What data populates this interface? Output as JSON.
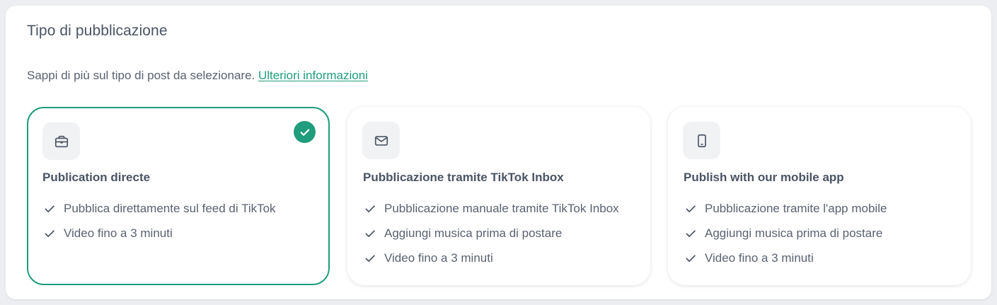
{
  "section": {
    "title": "Tipo di pubblicazione",
    "subtitle": "Sappi di più sul tipo di post da selezionare.",
    "link_label": "Ulteriori informazioni"
  },
  "cards": [
    {
      "title": "Publication directe",
      "icon": "briefcase-icon",
      "selected": true,
      "features": [
        "Pubblica direttamente sul feed di TikTok",
        "Video fino a 3 minuti"
      ]
    },
    {
      "title": "Pubblicazione tramite TikTok Inbox",
      "icon": "mail-icon",
      "selected": false,
      "features": [
        "Pubblicazione manuale tramite TikTok Inbox",
        "Aggiungi musica prima di postare",
        "Video fino a 3 minuti"
      ]
    },
    {
      "title": "Publish with our mobile app",
      "icon": "smartphone-icon",
      "selected": false,
      "features": [
        "Pubblicazione tramite l'app mobile",
        "Aggiungi musica prima di postare",
        "Video fino a 3 minuti"
      ]
    }
  ],
  "colors": {
    "accent": "#1f9d7c",
    "text": "#4a5463",
    "muted": "#5a6270"
  }
}
